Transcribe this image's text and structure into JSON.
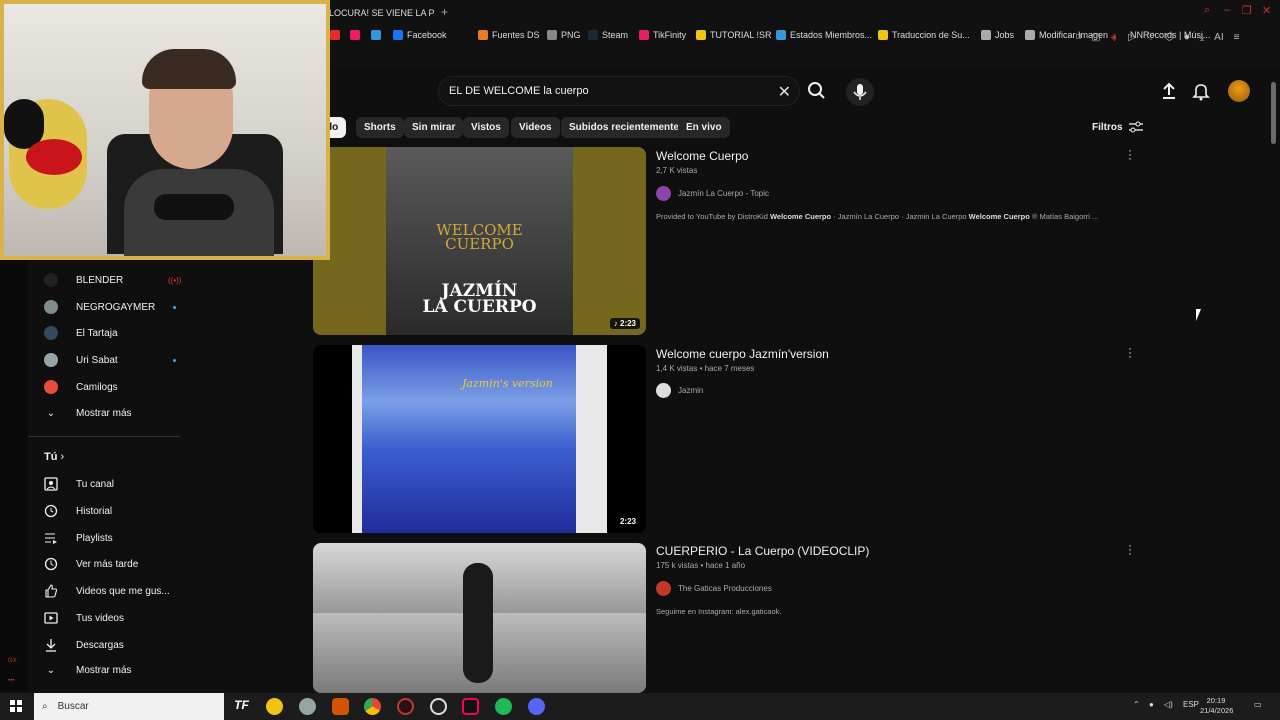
{
  "browser": {
    "tab_title": "¡LOCURA! SE VIENE LA PE",
    "bookmarks": [
      {
        "label": "Facebook",
        "color": "#1877f2"
      },
      {
        "label": "Fuentes DS",
        "color": "#e67e22"
      },
      {
        "label": "PNG",
        "color": "#888888"
      },
      {
        "label": "Steam",
        "color": "#1b2838"
      },
      {
        "label": "TikFinity",
        "color": "#e91e63"
      },
      {
        "label": "TUTORIAL !SR",
        "color": "#f1c40f"
      },
      {
        "label": "Estados Miembros...",
        "color": "#3498db"
      },
      {
        "label": "Traduccion de Su...",
        "color": "#f1c40f"
      },
      {
        "label": "Jobs",
        "color": "#aaaaaa"
      },
      {
        "label": "Modificar Imagen",
        "color": "#aaaaaa"
      },
      {
        "label": "NNRecords | Músi...",
        "color": "#111111"
      }
    ],
    "ai_label": "AI"
  },
  "search": {
    "query": "EL DE WELCOME la cuerpo"
  },
  "chips": [
    "do",
    "Shorts",
    "Sin mirar",
    "Vistos",
    "Videos",
    "Subidos recientemente",
    "En vivo"
  ],
  "filters_label": "Filtros",
  "sidebar": {
    "subscriptions": [
      {
        "label": "BLENDER",
        "status": "live",
        "color": "#222222"
      },
      {
        "label": "NEGROGAYMER",
        "status": "new",
        "color": "#7f8c8d"
      },
      {
        "label": "El Tartaja",
        "status": "",
        "color": "#34495e"
      },
      {
        "label": "Uri Sabat",
        "status": "new",
        "color": "#95a5a6"
      },
      {
        "label": "Camilogs",
        "status": "",
        "color": "#e74c3c"
      }
    ],
    "show_more_1": "Mostrar más",
    "you_title": "Tú",
    "you_items": [
      {
        "label": "Tu canal",
        "icon": "channel-icon"
      },
      {
        "label": "Historial",
        "icon": "history-icon"
      },
      {
        "label": "Playlists",
        "icon": "playlist-icon"
      },
      {
        "label": "Ver más tarde",
        "icon": "clock-icon"
      },
      {
        "label": "Videos que me gus...",
        "icon": "thumb-up-icon"
      },
      {
        "label": "Tus videos",
        "icon": "video-icon"
      },
      {
        "label": "Descargas",
        "icon": "download-icon"
      }
    ],
    "show_more_2": "Mostrar más"
  },
  "results": [
    {
      "title": "Welcome Cuerpo",
      "meta": "2,7 K vistas",
      "channel": "Jazmín La Cuerpo - Topic",
      "description_prefix": "Provided to YouTube by DistroKid ",
      "description_bold1": "Welcome Cuerpo",
      "description_mid": " · Jazmín La Cuerpo · Jazmin La Cuerpo ",
      "description_bold2": "Welcome Cuerpo",
      "description_suffix": " ℗ Matías Baigorri ...",
      "duration": "♪ 2:23",
      "thumb_line1": "WELCOME",
      "thumb_line2": "CUERPO",
      "thumb_line3": "JAZMÍN",
      "thumb_line4": "LA CUERPO",
      "channel_color": "#8e44ad"
    },
    {
      "title": "Welcome cuerpo Jazmín'version",
      "meta": "1,4 K vistas • hace 7 meses",
      "channel": "Jazmin",
      "duration": "2:23",
      "thumb_text": "Jazmin's version",
      "channel_color": "#dddddd"
    },
    {
      "title": "CUERPERIO - La Cuerpo (VIDEOCLIP)",
      "meta": "175 k vistas • hace 1 año",
      "channel": "The Gaticas Producciones",
      "description": "Seguime en Instagram: alex.gaticaok.",
      "channel_color": "#c0392b"
    }
  ],
  "taskbar": {
    "search_label": "Buscar",
    "lang": "ESP",
    "time": "20:19",
    "date": "21/4/2026"
  }
}
